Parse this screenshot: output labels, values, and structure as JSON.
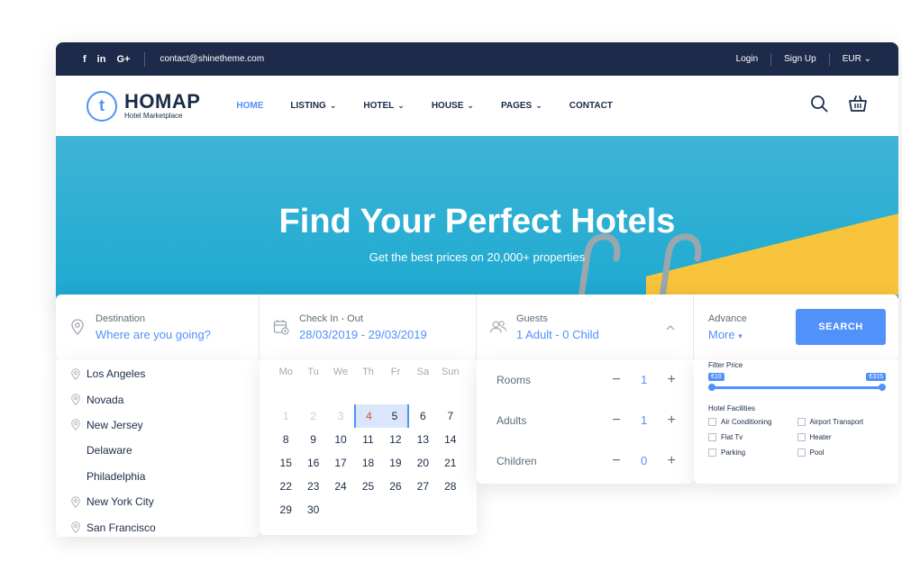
{
  "topbar": {
    "social": [
      "f",
      "in",
      "G+"
    ],
    "email": "contact@shinetheme.com",
    "login": "Login",
    "signup": "Sign Up",
    "currency": "EUR"
  },
  "nav": {
    "brand": "HOMAP",
    "tagline": "Hotel Marketplace",
    "logo_letter": "t",
    "menu": [
      "HOME",
      "LISTING",
      "HOTEL",
      "HOUSE",
      "PAGES",
      "CONTACT"
    ]
  },
  "hero": {
    "title": "Find Your Perfect Hotels",
    "subtitle": "Get the best prices on 20,000+ properties"
  },
  "search": {
    "destination_label": "Destination",
    "destination_placeholder": "Where are you going?",
    "dates_label": "Check In - Out",
    "dates_value": "28/03/2019 - 29/03/2019",
    "guests_label": "Guests",
    "guests_value": "1 Adult - 0 Child",
    "advance_label": "Advance",
    "advance_value": "More",
    "button": "SEARCH"
  },
  "destinations": [
    "Los Angeles",
    "Novada",
    "New Jersey",
    "Delaware",
    "Philadelphia",
    "New York City",
    "San Francisco"
  ],
  "calendar": {
    "weekdays": [
      "Mo",
      "Tu",
      "We",
      "Th",
      "Fr",
      "Sa",
      "Sun"
    ],
    "row1": [
      "1",
      "2",
      "3",
      "4",
      "5",
      "6",
      "7"
    ],
    "row2": [
      "8",
      "9",
      "10",
      "11",
      "12",
      "13",
      "14"
    ],
    "row3": [
      "15",
      "16",
      "17",
      "18",
      "19",
      "20",
      "21"
    ],
    "row4": [
      "22",
      "23",
      "24",
      "25",
      "26",
      "27",
      "28"
    ],
    "row5": [
      "29",
      "30"
    ]
  },
  "guests": {
    "rooms_label": "Rooms",
    "rooms": "1",
    "adults_label": "Adults",
    "adults": "1",
    "children_label": "Children",
    "children": "0"
  },
  "advance": {
    "filter_price": "Filter Price",
    "price_min": "€10",
    "price_max": "€315",
    "facilities_title": "Hotel Facilities",
    "facilities": [
      "Air Conditioning",
      "Airport Transport",
      "Flat Tv",
      "Heater",
      "Parking",
      "Pool"
    ]
  },
  "colors": {
    "accent": "#5191fa",
    "dark": "#1e2a4a",
    "hero": "#2aaed3"
  }
}
